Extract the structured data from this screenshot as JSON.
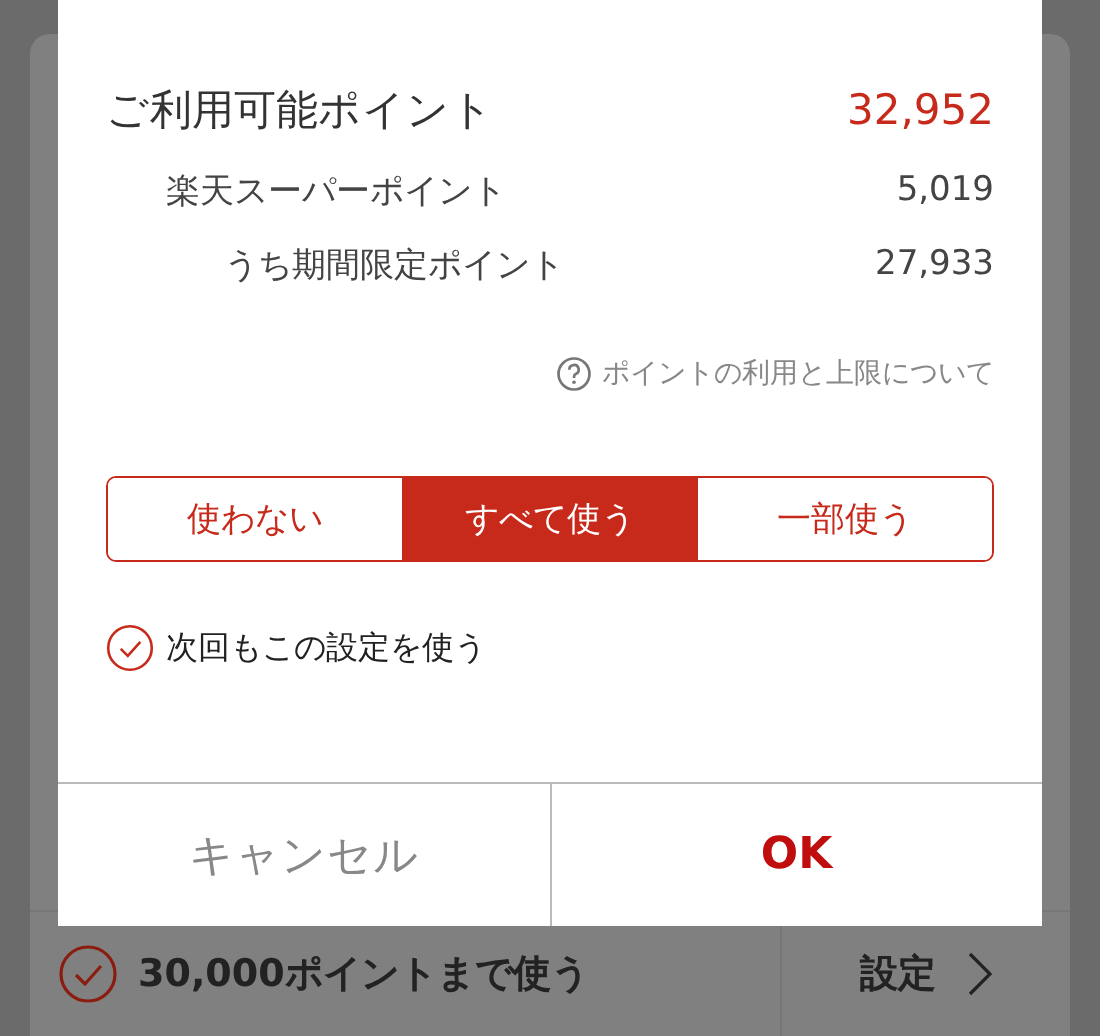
{
  "available": {
    "label": "ご利用可能ポイント",
    "value": "32,952"
  },
  "breakdown": [
    {
      "label": "楽天スーパーポイント",
      "value": "5,019",
      "children": [
        {
          "label": "うち期間限定ポイント",
          "value": "27,933"
        }
      ]
    }
  ],
  "help_link": "ポイントの利用と上限について",
  "usage_options": [
    {
      "label": "使わない",
      "selected": false
    },
    {
      "label": "すべて使う",
      "selected": true
    },
    {
      "label": "一部使う",
      "selected": false
    }
  ],
  "remember": {
    "label": "次回もこの設定を使う",
    "checked": true
  },
  "buttons": [
    {
      "label": "キャンセル",
      "kind": "cancel"
    },
    {
      "label": "OK",
      "kind": "primary"
    }
  ],
  "background": {
    "limit": {
      "label": "30,000ポイントまで使う",
      "checked": true
    },
    "settings": "設定"
  }
}
